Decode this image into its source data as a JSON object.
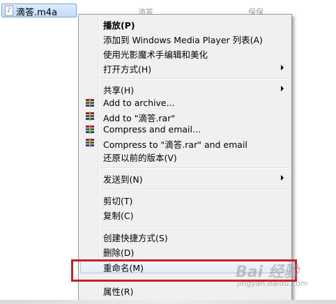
{
  "file": {
    "name": "滴答.m4a",
    "icon": "music-file-icon",
    "col_title": "滴答",
    "col_artist": "保保"
  },
  "menu": {
    "items": [
      {
        "id": "play",
        "label": "播放(P)",
        "bold": true
      },
      {
        "id": "add-to-wmp",
        "label": "添加到 Windows Media Player 列表(A)"
      },
      {
        "id": "beautify",
        "label": "使用光影魔术手编辑和美化"
      },
      {
        "id": "open-with",
        "label": "打开方式(H)",
        "submenu": true
      },
      {
        "id": "share",
        "label": "共享(H)",
        "submenu": true
      },
      {
        "id": "add-archive",
        "label": "Add to archive...",
        "icon": "winrar-icon"
      },
      {
        "id": "add-rar",
        "label": "Add to \"滴答.rar\"",
        "icon": "winrar-icon"
      },
      {
        "id": "compress-email",
        "label": "Compress and email...",
        "icon": "winrar-icon"
      },
      {
        "id": "compress-rar-email",
        "label": "Compress to \"滴答.rar\" and email",
        "icon": "winrar-icon"
      },
      {
        "id": "restore",
        "label": "还原以前的版本(V)"
      },
      {
        "id": "send-to",
        "label": "发送到(N)",
        "submenu": true
      },
      {
        "id": "cut",
        "label": "剪切(T)"
      },
      {
        "id": "copy",
        "label": "复制(C)"
      },
      {
        "id": "create-shortcut",
        "label": "创建快捷方式(S)"
      },
      {
        "id": "delete",
        "label": "删除(D)"
      },
      {
        "id": "rename",
        "label": "重命名(M)",
        "highlighted": true
      },
      {
        "id": "properties",
        "label": "属性(R)"
      }
    ]
  },
  "watermark": {
    "logo": "Bai 经验",
    "url": "jingyan.baidu.com"
  },
  "colors": {
    "highlight_border": "#c41e2a",
    "menu_bg": "#f0f0f0"
  }
}
